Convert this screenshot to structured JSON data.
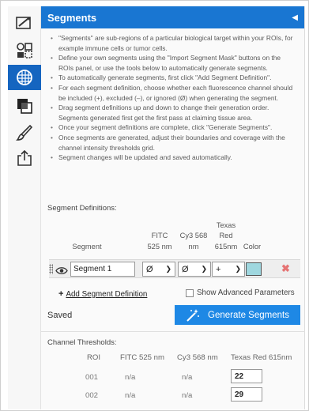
{
  "toolbar": {
    "tools": [
      {
        "icon": "edit-shape-icon"
      },
      {
        "icon": "roi-tools-icon"
      },
      {
        "icon": "segments-icon",
        "active": true
      },
      {
        "icon": "layers-icon"
      },
      {
        "icon": "brush-icon"
      },
      {
        "icon": "export-icon"
      }
    ]
  },
  "panel": {
    "title": "Segments",
    "accent": "#1976d2",
    "info_items": [
      "\"Segments\" are sub-regions of a particular biological target within your ROIs, for example immune cells or tumor cells.",
      "Define your own segments using the \"Import Segment Mask\" buttons on the ROIs panel, or use the tools below to automatically generate segments.",
      "To automatically generate segments, first click \"Add Segment Definition\".",
      "For each segment definition, choose whether each fluorescence channel should be included (+), excluded (–), or ignored (Ø) when generating the segment.",
      "Drag segment definitions up and down to change their generation order. Segments generated first get the first pass at claiming tissue area.",
      "Once your segment definitions are complete, click \"Generate Segments\".",
      "Once segments are generated, adjust their boundaries and coverage with the channel intensity thresholds grid.",
      "Segment changes will be updated and saved automatically."
    ]
  },
  "definitions": {
    "label": "Segment Definitions:",
    "headers": {
      "segment": "Segment",
      "fitc_line1": "FITC",
      "fitc_line2": "525 nm",
      "cy3_line1": "Cy3 568",
      "cy3_line2": "nm",
      "texas_line1": "Texas",
      "texas_line2": "Red",
      "texas_line3": "615nm",
      "color": "Color"
    },
    "rows": [
      {
        "name": "Segment 1",
        "fitc": "Ø",
        "cy3": "Ø",
        "texas": "+",
        "color": "#9fd7df"
      }
    ],
    "add_label": "Add Segment Definition",
    "advanced_label": "Show Advanced Parameters",
    "advanced_checked": false
  },
  "status": {
    "saved_label": "Saved",
    "generate_label": "Generate Segments",
    "button_color": "#1e88e5"
  },
  "thresholds": {
    "label": "Channel Thresholds:",
    "headers": [
      "ROI",
      "FITC 525 nm",
      "Cy3 568 nm",
      "Texas Red 615nm"
    ],
    "rows": [
      {
        "roi": "001",
        "fitc": "n/a",
        "cy3": "n/a",
        "texas": "22"
      },
      {
        "roi": "002",
        "fitc": "n/a",
        "cy3": "n/a",
        "texas": "29"
      }
    ]
  }
}
